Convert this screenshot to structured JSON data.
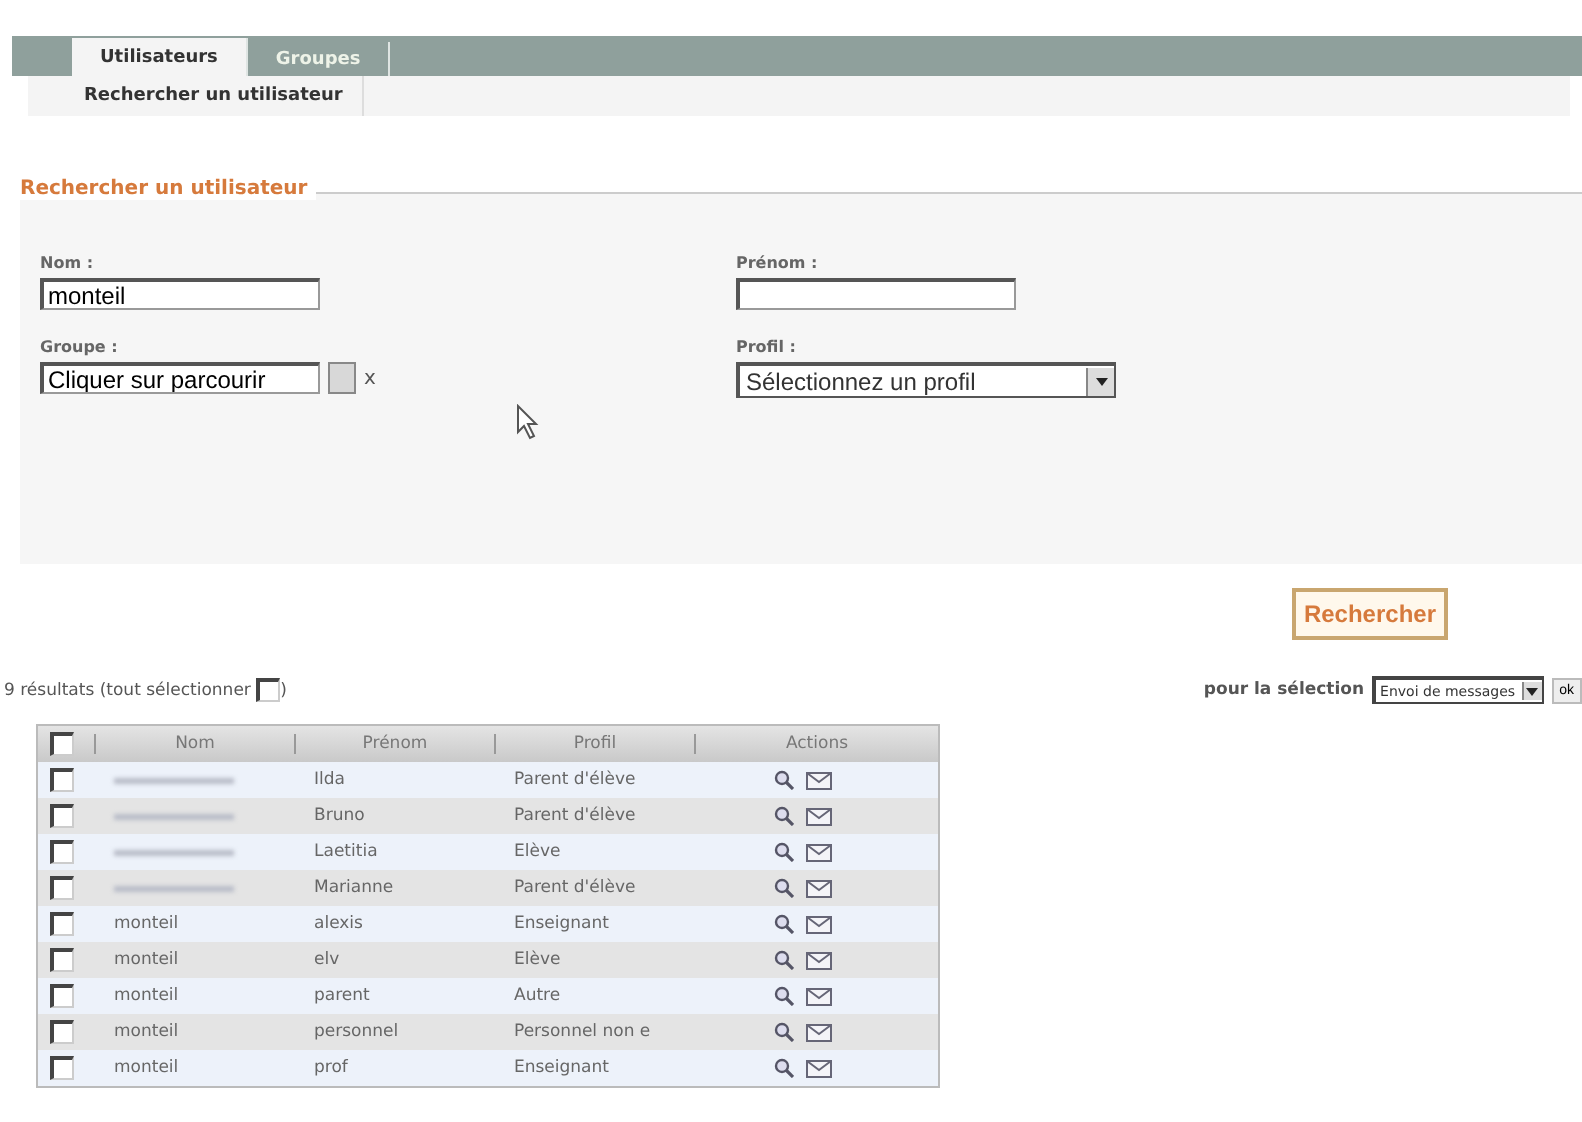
{
  "tabs": [
    {
      "label": "Utilisateurs",
      "selected": true
    },
    {
      "label": "Groupes",
      "selected": false
    }
  ],
  "subnav": {
    "label": "Rechercher un utilisateur"
  },
  "search_form": {
    "legend": "Rechercher un utilisateur",
    "fields": [
      {
        "label": "Nom :",
        "kind": "text",
        "value": "monteil"
      },
      {
        "label": "Prénom :",
        "kind": "text"
      },
      {
        "label": "Groupe :",
        "kind": "browse",
        "value": "Cliquer sur parcourir",
        "clear": "x"
      },
      {
        "label": "Profil :",
        "kind": "select",
        "value": "Sélectionnez un profil"
      }
    ],
    "submit": "Rechercher"
  },
  "results": {
    "count_text": "9 résultats (tout sélectionner",
    "close_paren": ")",
    "select_all": false,
    "selection_label": "pour la sélection",
    "selection_action": "Envoi de messages",
    "ok": "ok"
  },
  "table": {
    "columns": [
      "Nom",
      "Prénom",
      "Profil",
      "Actions"
    ],
    "all_checked": false,
    "rows": [
      {
        "nom_redacted": true,
        "prenom": "Ilda",
        "profil": "Parent d'élève",
        "checked": false
      },
      {
        "nom_redacted": true,
        "prenom": "Bruno",
        "profil": "Parent d'élève",
        "checked": false
      },
      {
        "nom_redacted": true,
        "prenom": "Laetitia",
        "profil": "Elève",
        "checked": false
      },
      {
        "nom_redacted": true,
        "prenom": "Marianne",
        "profil": "Parent d'élève",
        "checked": false
      },
      {
        "nom": "monteil",
        "prenom": "alexis",
        "profil": "Enseignant",
        "checked": false
      },
      {
        "nom": "monteil",
        "prenom": "elv",
        "profil": "Elève",
        "checked": false
      },
      {
        "nom": "monteil",
        "prenom": "parent",
        "profil": "Autre",
        "checked": false
      },
      {
        "nom": "monteil",
        "prenom": "personnel",
        "profil": "Personnel non e",
        "checked": false
      },
      {
        "nom": "monteil",
        "prenom": "prof",
        "profil": "Enseignant",
        "checked": false
      }
    ]
  }
}
